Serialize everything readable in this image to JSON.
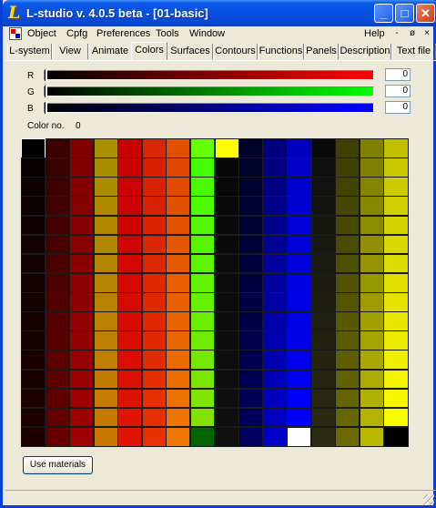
{
  "window": {
    "title": "L-studio v. 4.0.5 beta - [01-basic]",
    "logo": "L",
    "controls": {
      "minimize": "_",
      "maximize": "□",
      "close": "✕"
    }
  },
  "menubar": {
    "items": [
      "Object",
      "Cpfg",
      "Preferences",
      "Tools",
      "Window"
    ],
    "help": "Help",
    "mdi_controls": [
      "-",
      "ø",
      "×"
    ]
  },
  "tabs": {
    "items": [
      "L-system",
      "View",
      "Animate",
      "Colors",
      "Surfaces",
      "Contours",
      "Functions",
      "Panels",
      "Description",
      "Text file"
    ],
    "active": "Colors"
  },
  "colors_panel": {
    "sliders": [
      {
        "label": "R",
        "value": "0",
        "gradient_end": "#ff0000"
      },
      {
        "label": "G",
        "value": "0",
        "gradient_end": "#00ff00"
      },
      {
        "label": "B",
        "value": "0",
        "gradient_end": "#0000ff"
      }
    ],
    "color_no_label": "Color no.",
    "color_no_value": "0",
    "use_materials_label": "Use materials",
    "palette": {
      "rows": 16,
      "columns": [
        {
          "top": "#000000",
          "ramp": [
            "#0a0000",
            "#200000"
          ]
        },
        {
          "top": "#3c0000",
          "ramp": [
            "#3c0000",
            "#660000"
          ]
        },
        {
          "top": "#820000",
          "ramp": [
            "#820000",
            "#a00000"
          ]
        },
        {
          "top": "#a89000",
          "ramp": [
            "#a88c00",
            "#c87800"
          ]
        },
        {
          "top": "#c80000",
          "ramp": [
            "#c80000",
            "#e01400"
          ]
        },
        {
          "top": "#d82800",
          "ramp": [
            "#d82000",
            "#e83000"
          ]
        },
        {
          "top": "#e05000",
          "ramp": [
            "#e04800",
            "#f07800"
          ]
        },
        {
          "top": "#66ff00",
          "ramp": [
            "#44ff00",
            "#88e000"
          ],
          "bottom": "#006400"
        },
        {
          "top": "#ffff00",
          "ramp": [
            "#080808",
            "#101010"
          ]
        },
        {
          "top": "#00002a",
          "ramp": [
            "#00002a",
            "#000060"
          ]
        },
        {
          "top": "#000080",
          "ramp": [
            "#000080",
            "#0000c8"
          ]
        },
        {
          "top": "#0000c0",
          "ramp": [
            "#0000c8",
            "#0000ff"
          ],
          "bottom": "#ffffff"
        },
        {
          "top": "#0a0a0a",
          "ramp": [
            "#101010",
            "#2c2c10"
          ]
        },
        {
          "top": "#404000",
          "ramp": [
            "#404000",
            "#6a6a00"
          ]
        },
        {
          "top": "#808000",
          "ramp": [
            "#808000",
            "#b8b800"
          ]
        },
        {
          "top": "#c0c000",
          "ramp": [
            "#c8c800",
            "#ffff00"
          ],
          "bottom": "#000000"
        }
      ]
    }
  }
}
